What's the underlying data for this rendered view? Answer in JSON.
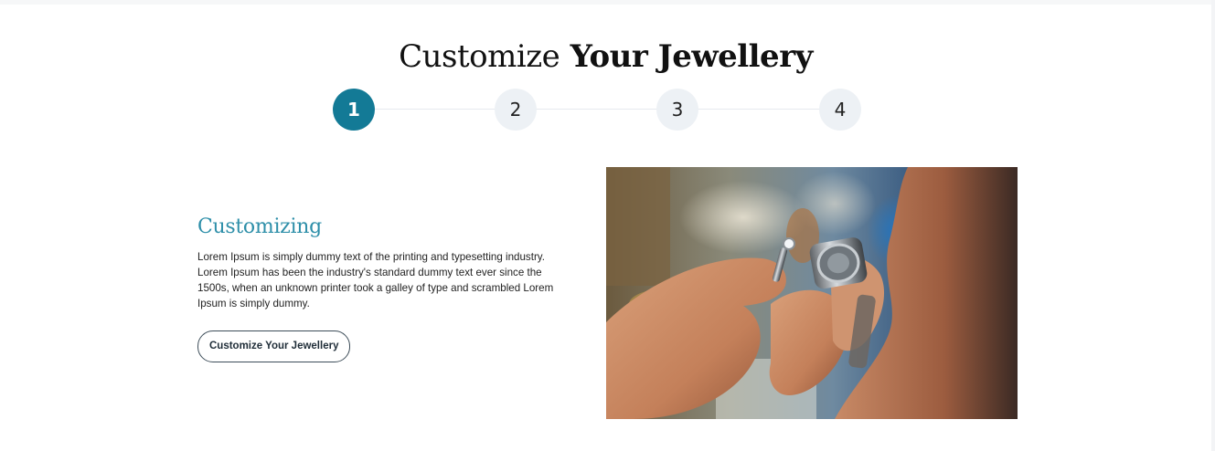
{
  "header": {
    "title_light": "Customize",
    "title_bold": "Your Jewellery"
  },
  "stepper": {
    "steps": [
      {
        "label": "1",
        "active": true
      },
      {
        "label": "2",
        "active": false
      },
      {
        "label": "3",
        "active": false
      },
      {
        "label": "4",
        "active": false
      }
    ],
    "active_color": "#137a96",
    "inactive_color": "#edf1f5"
  },
  "section": {
    "heading": "Customizing",
    "body": "Lorem Ipsum is simply dummy text of the printing and typesetting industry. Lorem Ipsum has been the industry's standard dummy text ever since the 1500s, when an unknown printer took a galley of type and scrambled Lorem Ipsum is simply dummy.",
    "button_label": "Customize Your Jewellery",
    "heading_color": "#2e8fa9"
  },
  "image": {
    "subject": "jeweller-inspecting-ring-with-loupe"
  }
}
